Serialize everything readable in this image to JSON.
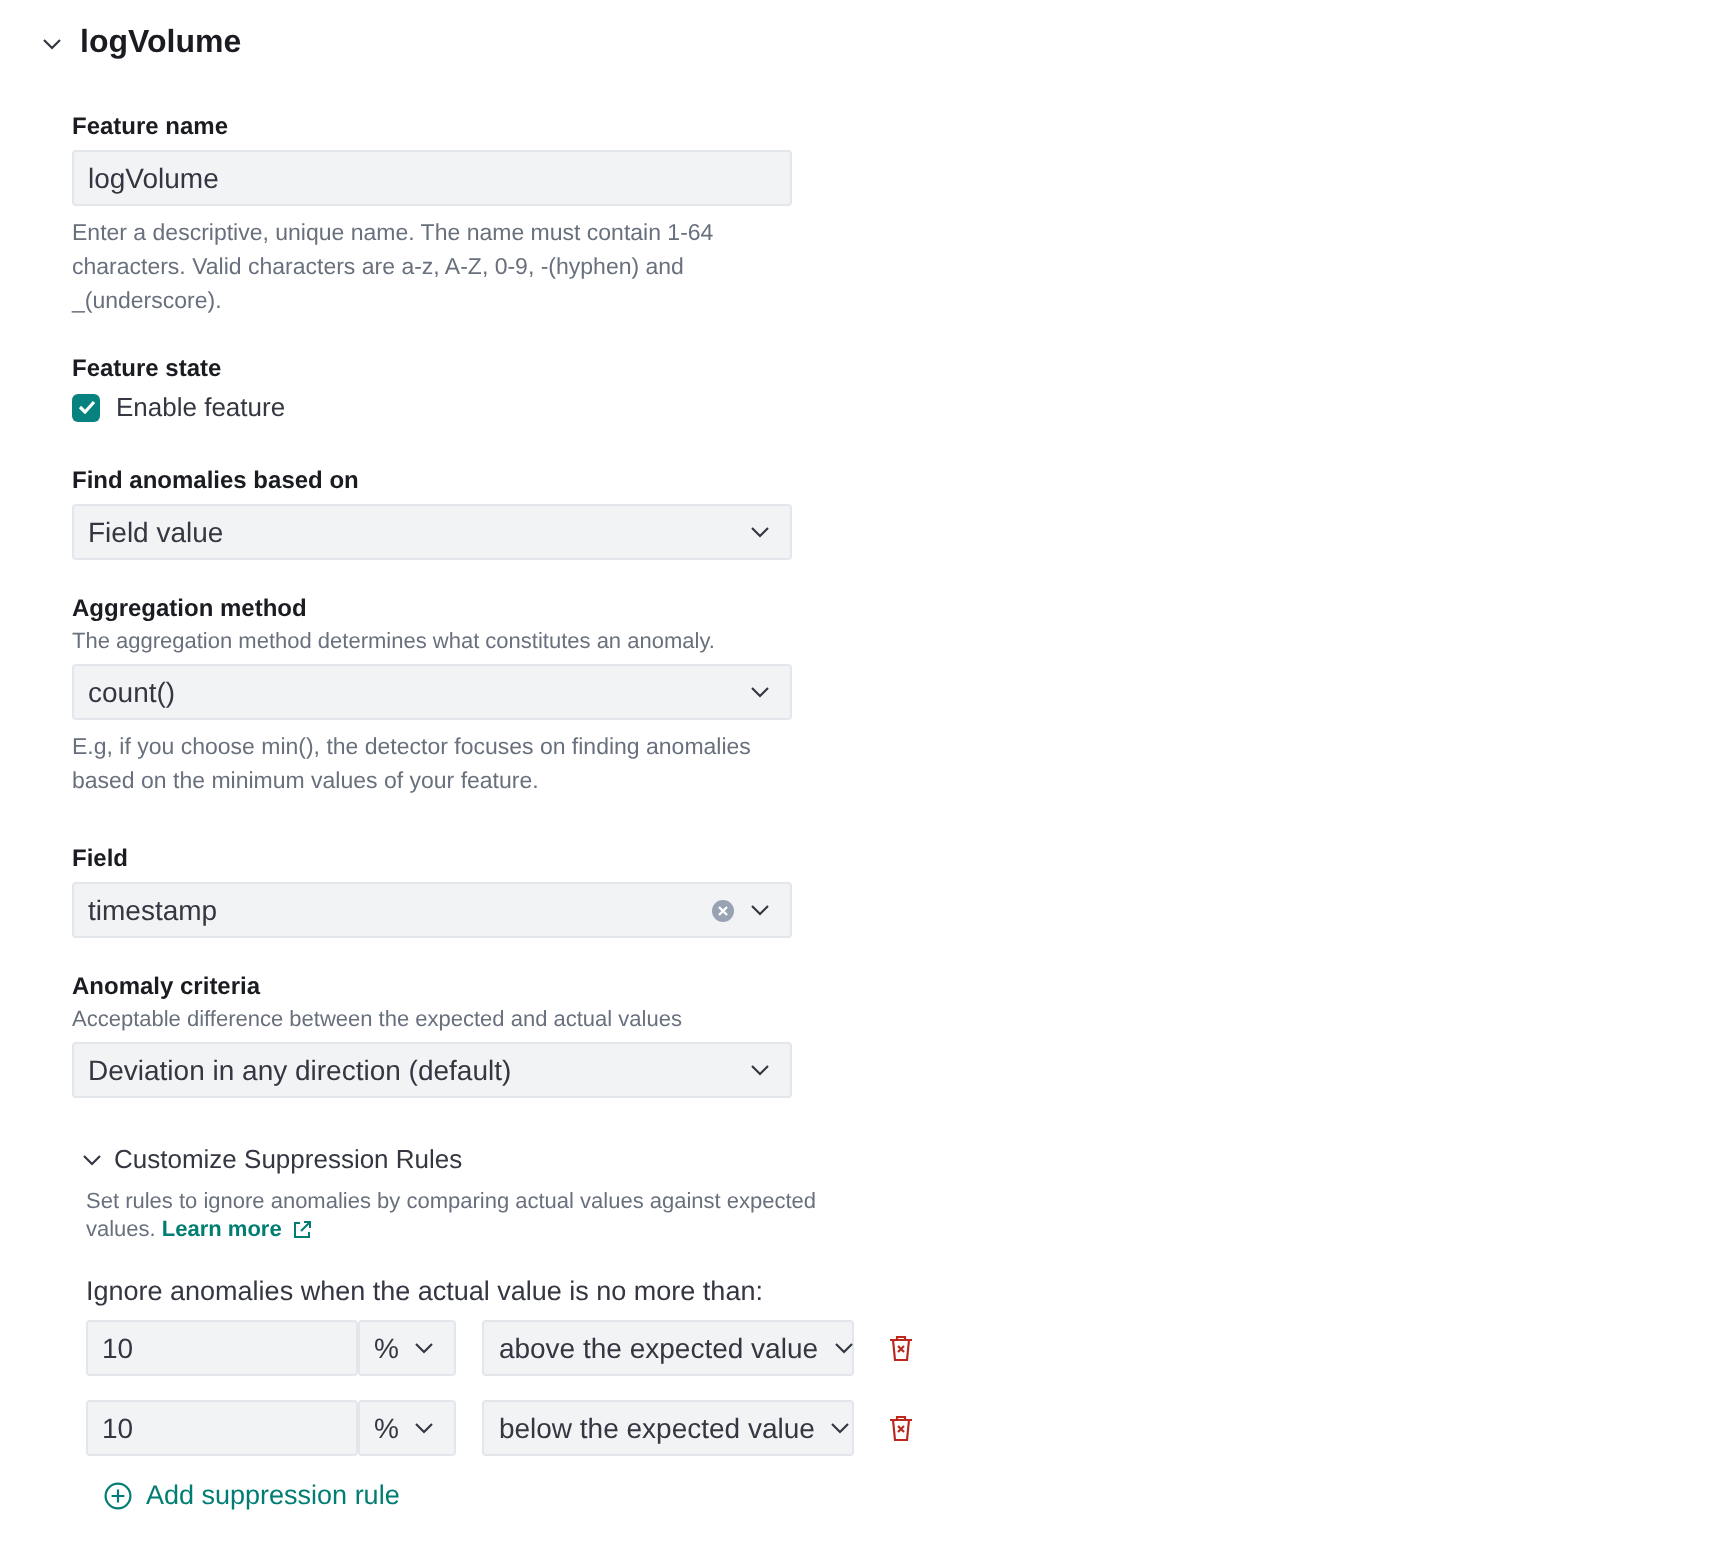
{
  "section": {
    "title": "logVolume",
    "expanded": true
  },
  "feature_name": {
    "label": "Feature name",
    "value": "logVolume",
    "help": "Enter a descriptive, unique name. The name must contain 1-64 characters. Valid characters are a-z, A-Z, 0-9, -(hyphen) and _(underscore)."
  },
  "feature_state": {
    "label": "Feature state",
    "option": "Enable feature",
    "checked": true
  },
  "find_anomalies": {
    "label": "Find anomalies based on",
    "value": "Field value"
  },
  "aggregation": {
    "label": "Aggregation method",
    "description": "The aggregation method determines what constitutes an anomaly.",
    "value": "count()",
    "help": "E.g, if you choose min(), the detector focuses on finding anomalies based on the minimum values of your feature."
  },
  "field": {
    "label": "Field",
    "value": "timestamp",
    "clearable": true
  },
  "anomaly_criteria": {
    "label": "Anomaly criteria",
    "description": "Acceptable difference between the expected and actual values",
    "value": "Deviation in any direction (default)"
  },
  "suppression": {
    "title": "Customize Suppression Rules",
    "expanded": true,
    "description": "Set rules to ignore anomalies by comparing actual values against expected values.",
    "link": "Learn more",
    "intro": "Ignore anomalies when the actual value is no more than:",
    "rules": [
      {
        "amount": "10",
        "unit": "%",
        "direction": "above the expected value"
      },
      {
        "amount": "10",
        "unit": "%",
        "direction": "below the expected value"
      }
    ],
    "add_label": "Add suppression rule"
  }
}
